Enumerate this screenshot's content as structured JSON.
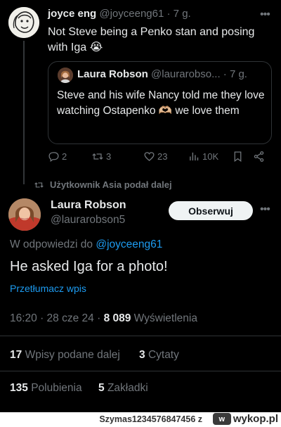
{
  "parent": {
    "name": "joyce eng",
    "handle": "@joyceeng61",
    "time": "· 7 g.",
    "text": "Not Steve being a Penko stan and posing with Iga 😭",
    "quote": {
      "name": "Laura Robson",
      "handle": "@laurarobso...",
      "time": "· 7 g.",
      "text": "Steve and his wife Nancy told me they love watching Ostapenko 🫶🏼 we love them"
    },
    "actions": {
      "replies": "2",
      "reposts": "3",
      "likes": "23",
      "views": "10K"
    }
  },
  "repost_notice": "Użytkownik Asia podał dalej",
  "main": {
    "name": "Laura Robson",
    "handle": "@laurarobson5",
    "follow_label": "Obserwuj",
    "reply_prefix": "W odpowiedzi do",
    "reply_handle": "@joyceeng61",
    "text": "He asked Iga for a photo!",
    "translate": "Przetłumacz wpis",
    "meta_time": "16:20 · 28 cze 24 ·",
    "meta_views_count": "8 089",
    "meta_views_label": "Wyświetlenia",
    "reposts_count": "17",
    "reposts_label": "Wpisy podane dalej",
    "quotes_count": "3",
    "quotes_label": "Cytaty",
    "likes_count": "135",
    "likes_label": "Polubienia",
    "bookmarks_count": "5",
    "bookmarks_label": "Zakładki"
  },
  "banner": {
    "credit": "Szymas1234576847456 z",
    "site": "wykop.pl",
    "logo_glyph": "w"
  },
  "icons": [
    "more-icon",
    "reply-icon",
    "repost-icon",
    "like-icon",
    "views-icon",
    "bookmark-icon",
    "share-icon"
  ],
  "colors": {
    "background": "#000000",
    "text": "#e7e9ea",
    "muted": "#71767b",
    "link": "#1d9bf0",
    "border": "#2f3336"
  }
}
